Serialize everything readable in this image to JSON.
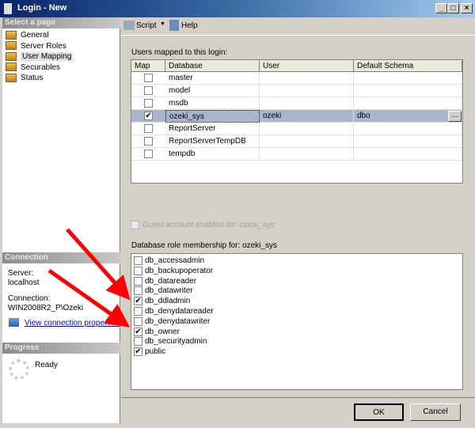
{
  "window": {
    "title": "Login - New",
    "minimize": "_",
    "maximize": "□",
    "close": "×"
  },
  "sidebar": {
    "header": "Select a page",
    "items": [
      {
        "label": "General"
      },
      {
        "label": "Server Roles"
      },
      {
        "label": "User Mapping",
        "selected": true
      },
      {
        "label": "Securables"
      },
      {
        "label": "Status"
      }
    ]
  },
  "connection": {
    "header": "Connection",
    "server_label": "Server:",
    "server": "localhost",
    "connection_label": "Connection:",
    "connection": "WIN2008R2_P\\Ozeki",
    "link": "View connection properties"
  },
  "progress": {
    "header": "Progress",
    "status": "Ready"
  },
  "toolbar": {
    "script": "Script",
    "help": "Help"
  },
  "mapping": {
    "label": "Users mapped to this login:",
    "columns": [
      "Map",
      "Database",
      "User",
      "Default Schema"
    ],
    "rows": [
      {
        "map": false,
        "database": "master",
        "user": "",
        "schema": ""
      },
      {
        "map": false,
        "database": "model",
        "user": "",
        "schema": ""
      },
      {
        "map": false,
        "database": "msdb",
        "user": "",
        "schema": ""
      },
      {
        "map": true,
        "database": "ozeki_sys",
        "user": "ozeki",
        "schema": "dbo",
        "selected": true
      },
      {
        "map": false,
        "database": "ReportServer",
        "user": "",
        "schema": ""
      },
      {
        "map": false,
        "database": "ReportServerTempDB",
        "user": "",
        "schema": ""
      },
      {
        "map": false,
        "database": "tempdb",
        "user": "",
        "schema": ""
      }
    ],
    "browse": "..."
  },
  "guest": {
    "label": "Guest account enabled for: ozeki_sys",
    "checked": false,
    "disabled": true
  },
  "roles": {
    "label": "Database role membership for: ozeki_sys",
    "items": [
      {
        "name": "db_accessadmin",
        "checked": false
      },
      {
        "name": "db_backupoperator",
        "checked": false
      },
      {
        "name": "db_datareader",
        "checked": false
      },
      {
        "name": "db_datawriter",
        "checked": false
      },
      {
        "name": "db_ddladmin",
        "checked": true
      },
      {
        "name": "db_denydatareader",
        "checked": false
      },
      {
        "name": "db_denydatawriter",
        "checked": false
      },
      {
        "name": "db_owner",
        "checked": true
      },
      {
        "name": "db_securityadmin",
        "checked": false
      },
      {
        "name": "public",
        "checked": true
      }
    ]
  },
  "buttons": {
    "ok": "OK",
    "cancel": "Cancel"
  },
  "colors": {
    "arrow": "#ff0000",
    "selected_row": "#a9b5cd"
  }
}
